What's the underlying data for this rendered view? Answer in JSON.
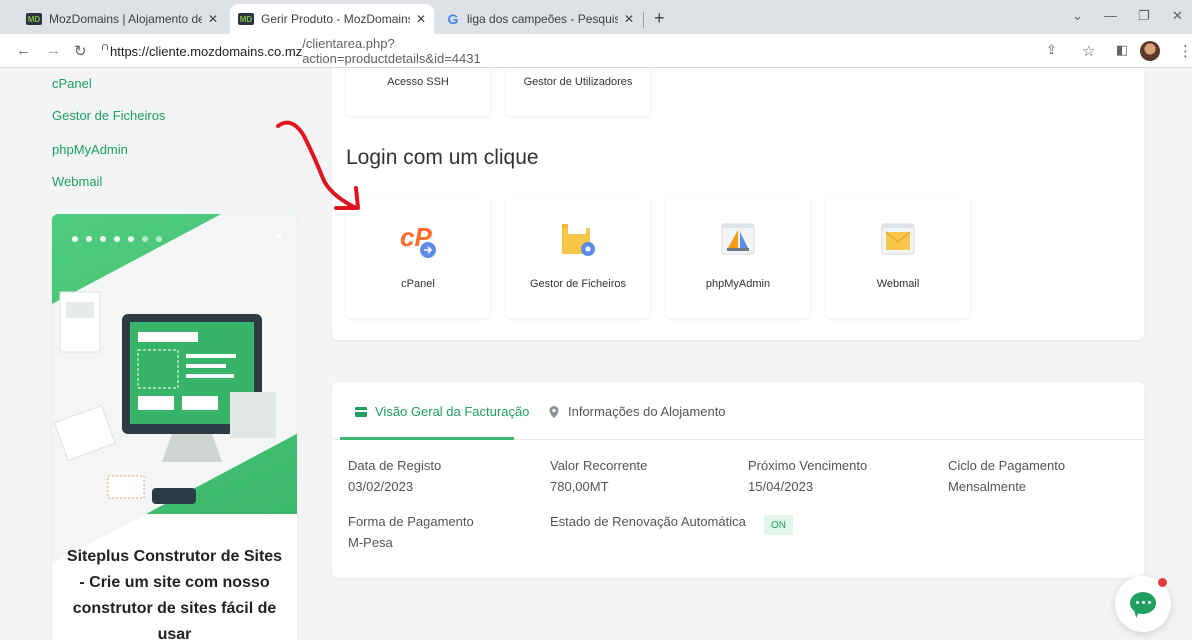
{
  "browser": {
    "tabs": [
      {
        "favicon": "MD",
        "title": "MozDomains | Alojamento de Si",
        "close": "✕"
      },
      {
        "favicon": "MD",
        "title": "Gerir Produto - MozDomains",
        "close": "✕"
      },
      {
        "favicon": "G",
        "title": "liga dos campeões - Pesquisa Go",
        "close": "✕"
      }
    ],
    "new_tab": "+",
    "url_host": "https://cliente.mozdomains.co.mz",
    "url_path": "/clientarea.php?action=productdetails&id=4431"
  },
  "sidebar": {
    "links": [
      "cPanel",
      "Gestor de Ficheiros",
      "phpMyAdmin",
      "Webmail"
    ]
  },
  "promo": {
    "close": "×",
    "text": "Siteplus Construtor de Sites - Crie um site com nosso construtor de sites fácil de usar"
  },
  "tools_top": [
    "Acesso SSH",
    "Gestor de Utilizadores"
  ],
  "login": {
    "title": "Login com um clique",
    "tiles": [
      "cPanel",
      "Gestor de Ficheiros",
      "phpMyAdmin",
      "Webmail"
    ]
  },
  "billing": {
    "tabs": [
      "Visão Geral da Facturação",
      "Informações do Alojamento"
    ],
    "fields": [
      {
        "label": "Data de Registo",
        "value": "03/02/2023"
      },
      {
        "label": "Valor Recorrente",
        "value": "780,00MT"
      },
      {
        "label": "Próximo Vencimento",
        "value": "15/04/2023"
      },
      {
        "label": "Ciclo de Pagamento",
        "value": "Mensalmente"
      },
      {
        "label": "Forma de Pagamento",
        "value": "M-Pesa"
      },
      {
        "label": "Estado de Renovação Automática",
        "value": "ON"
      }
    ]
  },
  "colors": {
    "accent": "#1fa060",
    "annotation": "#e0141e"
  }
}
